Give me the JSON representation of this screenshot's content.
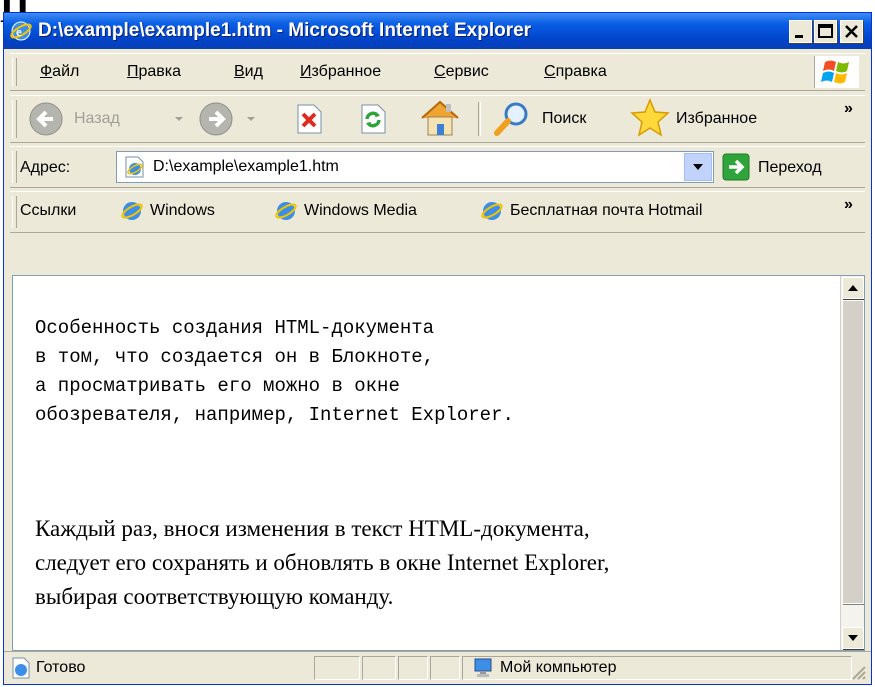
{
  "slide": {
    "heading_fragment": "П"
  },
  "window": {
    "title": "D:\\example\\example1.htm - Microsoft Internet Explorer",
    "controls": {
      "minimize": "minimize-icon",
      "maximize": "maximize-icon",
      "close": "close-icon"
    }
  },
  "menu": {
    "items": [
      "Файл",
      "Правка",
      "Вид",
      "Избранное",
      "Сервис",
      "Справка"
    ]
  },
  "toolbar": {
    "back_label": "Назад",
    "search_label": "Поиск",
    "favorites_label": "Избранное",
    "more": "»"
  },
  "address": {
    "label": "Адрес:",
    "value": "D:\\example\\example1.htm",
    "go_label": "Переход"
  },
  "links": {
    "label": "Ссылки",
    "items": [
      "Windows",
      "Windows Media",
      "Бесплатная почта Hotmail"
    ],
    "more": "»"
  },
  "content": {
    "mono_lines": [
      "Особенность создания HTML-документа",
      "в том, что создается он в Блокноте,",
      "а просматривать его можно в окне",
      "обозревателя, например, Internet Explorer."
    ],
    "serif_lines": [
      "Каждый раз, внося изменения в текст HTML-документа,",
      "следует его сохранять и обновлять в окне Internet Explorer,",
      "выбирая соответствующую команду."
    ]
  },
  "status": {
    "text": "Готово",
    "zone": "Мой компьютер"
  },
  "colors": {
    "titlebar": "#0a5ee5",
    "chrome": "#ece9d8",
    "go_green": "#2ea43a"
  }
}
